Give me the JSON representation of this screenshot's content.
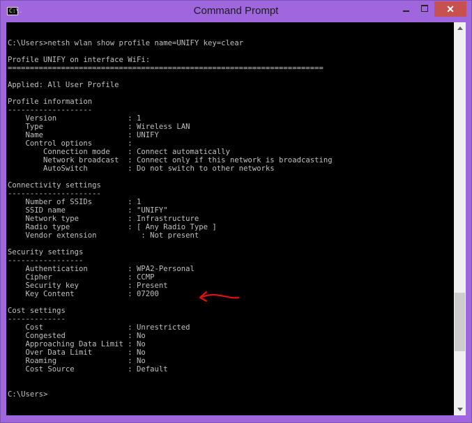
{
  "window": {
    "title": "Command Prompt",
    "icon_text": "C:\\.",
    "close_glyph": "✕"
  },
  "console": {
    "lines": [
      "C:\\Users>netsh wlan show profile name=UNIFY key=clear",
      "",
      "Profile UNIFY on interface WiFi:",
      "=======================================================================",
      "",
      "Applied: All User Profile",
      "",
      "Profile information",
      "-------------------",
      "    Version                : 1",
      "    Type                   : Wireless LAN",
      "    Name                   : UNIFY",
      "    Control options        :",
      "        Connection mode    : Connect automatically",
      "        Network broadcast  : Connect only if this network is broadcasting",
      "        AutoSwitch         : Do not switch to other networks",
      "",
      "Connectivity settings",
      "---------------------",
      "    Number of SSIDs        : 1",
      "    SSID name              : \"UNIFY\"",
      "    Network type           : Infrastructure",
      "    Radio type             : [ Any Radio Type ]",
      "    Vendor extension          : Not present",
      "",
      "Security settings",
      "-----------------",
      "    Authentication         : WPA2-Personal",
      "    Cipher                 : CCMP",
      "    Security key           : Present",
      "    Key Content            : 07200",
      "",
      "Cost settings",
      "-------------",
      "    Cost                   : Unrestricted",
      "    Congested              : No",
      "    Approaching Data Limit : No",
      "    Over Data Limit        : No",
      "    Roaming                : No",
      "    Cost Source            : Default",
      "",
      "",
      "C:\\Users>"
    ]
  },
  "annotation": {
    "color": "#e01010",
    "icon": "red-arrow-annotation"
  },
  "colors": {
    "title_bar": "#a066dd",
    "console_bg": "#000000",
    "console_fg": "#c0c0c0",
    "close_button": "#c75050"
  }
}
